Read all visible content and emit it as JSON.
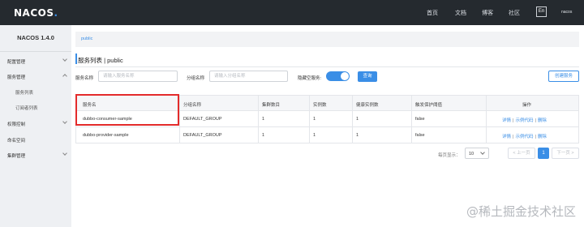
{
  "brand": {
    "name": "NACOS",
    "dot": "."
  },
  "topnav": {
    "items": [
      "首页",
      "文档",
      "博客",
      "社区"
    ],
    "lang": "En",
    "user": "nacos"
  },
  "sidebar": {
    "title": "NACOS 1.4.0",
    "items": [
      {
        "label": "配置管理"
      },
      {
        "label": "服务管理"
      },
      {
        "label": "服务列表"
      },
      {
        "label": "订阅者列表"
      },
      {
        "label": "权限控制"
      },
      {
        "label": "命名空间"
      },
      {
        "label": "集群管理"
      }
    ]
  },
  "breadcrumb": {
    "namespace": "public"
  },
  "page": {
    "title": "服务列表  |  public"
  },
  "filters": {
    "service_name_label": "服务名称",
    "service_name_placeholder": "请输入服务名称",
    "group_name_label": "分组名称",
    "group_name_placeholder": "请输入分组名称",
    "hide_empty_label": "隐藏空服务:",
    "hide_empty_on": true,
    "query_button": "查询",
    "create_button": "创建服务"
  },
  "table": {
    "columns": [
      "服务名",
      "分组名称",
      "集群数目",
      "实例数",
      "健康实例数",
      "触发保护阈值",
      "操作"
    ],
    "rows": [
      {
        "service": "dubbo-consumer-sample",
        "group": "DEFAULT_GROUP",
        "clusters": "1",
        "instances": "1",
        "healthy": "1",
        "threshold": "false"
      },
      {
        "service": "dubbo-provider-sample",
        "group": "DEFAULT_GROUP",
        "clusters": "1",
        "instances": "1",
        "healthy": "1",
        "threshold": "false"
      }
    ],
    "ops": {
      "detail": "详情",
      "sample": "示例代码",
      "delete": "删除",
      "sep": "|"
    }
  },
  "pager": {
    "size_label": "每页显示：",
    "size": "10",
    "prev": "< 上一页",
    "page": "1",
    "next": "下一页 >"
  },
  "watermark": "@稀土掘金技术社区",
  "colors": {
    "primary": "#3a8ee6",
    "topbar": "#252a2f",
    "sidebar": "#eef0f3",
    "highlight": "#e32b2b"
  }
}
